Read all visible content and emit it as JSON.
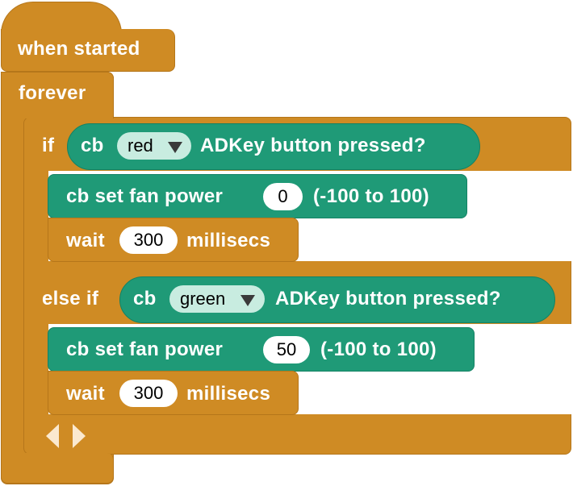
{
  "hat": {
    "label": "when started"
  },
  "forever": {
    "label": "forever"
  },
  "if_block": {
    "if_label": "if",
    "else_if_label": "else if"
  },
  "cond1": {
    "prefix": "cb",
    "color_value": "red",
    "suffix": "ADKey button pressed?"
  },
  "cmd1": {
    "prefix": "cb set fan power",
    "value": "0",
    "suffix": "(-100 to 100)"
  },
  "wait1": {
    "prefix": "wait",
    "value": "300",
    "suffix": "millisecs"
  },
  "cond2": {
    "prefix": "cb",
    "color_value": "green",
    "suffix": "ADKey button pressed?"
  },
  "cmd2": {
    "prefix": "cb set fan power",
    "value": "50",
    "suffix": "(-100 to 100)"
  },
  "wait2": {
    "prefix": "wait",
    "value": "300",
    "suffix": "millisecs"
  },
  "icons": {
    "collapse": "arrow-left-icon",
    "expand": "arrow-right-icon"
  },
  "colors": {
    "control_orange": "#cf8b24",
    "robot_teal": "#1f9a77",
    "dropdown_bg": "#c8ece0"
  }
}
